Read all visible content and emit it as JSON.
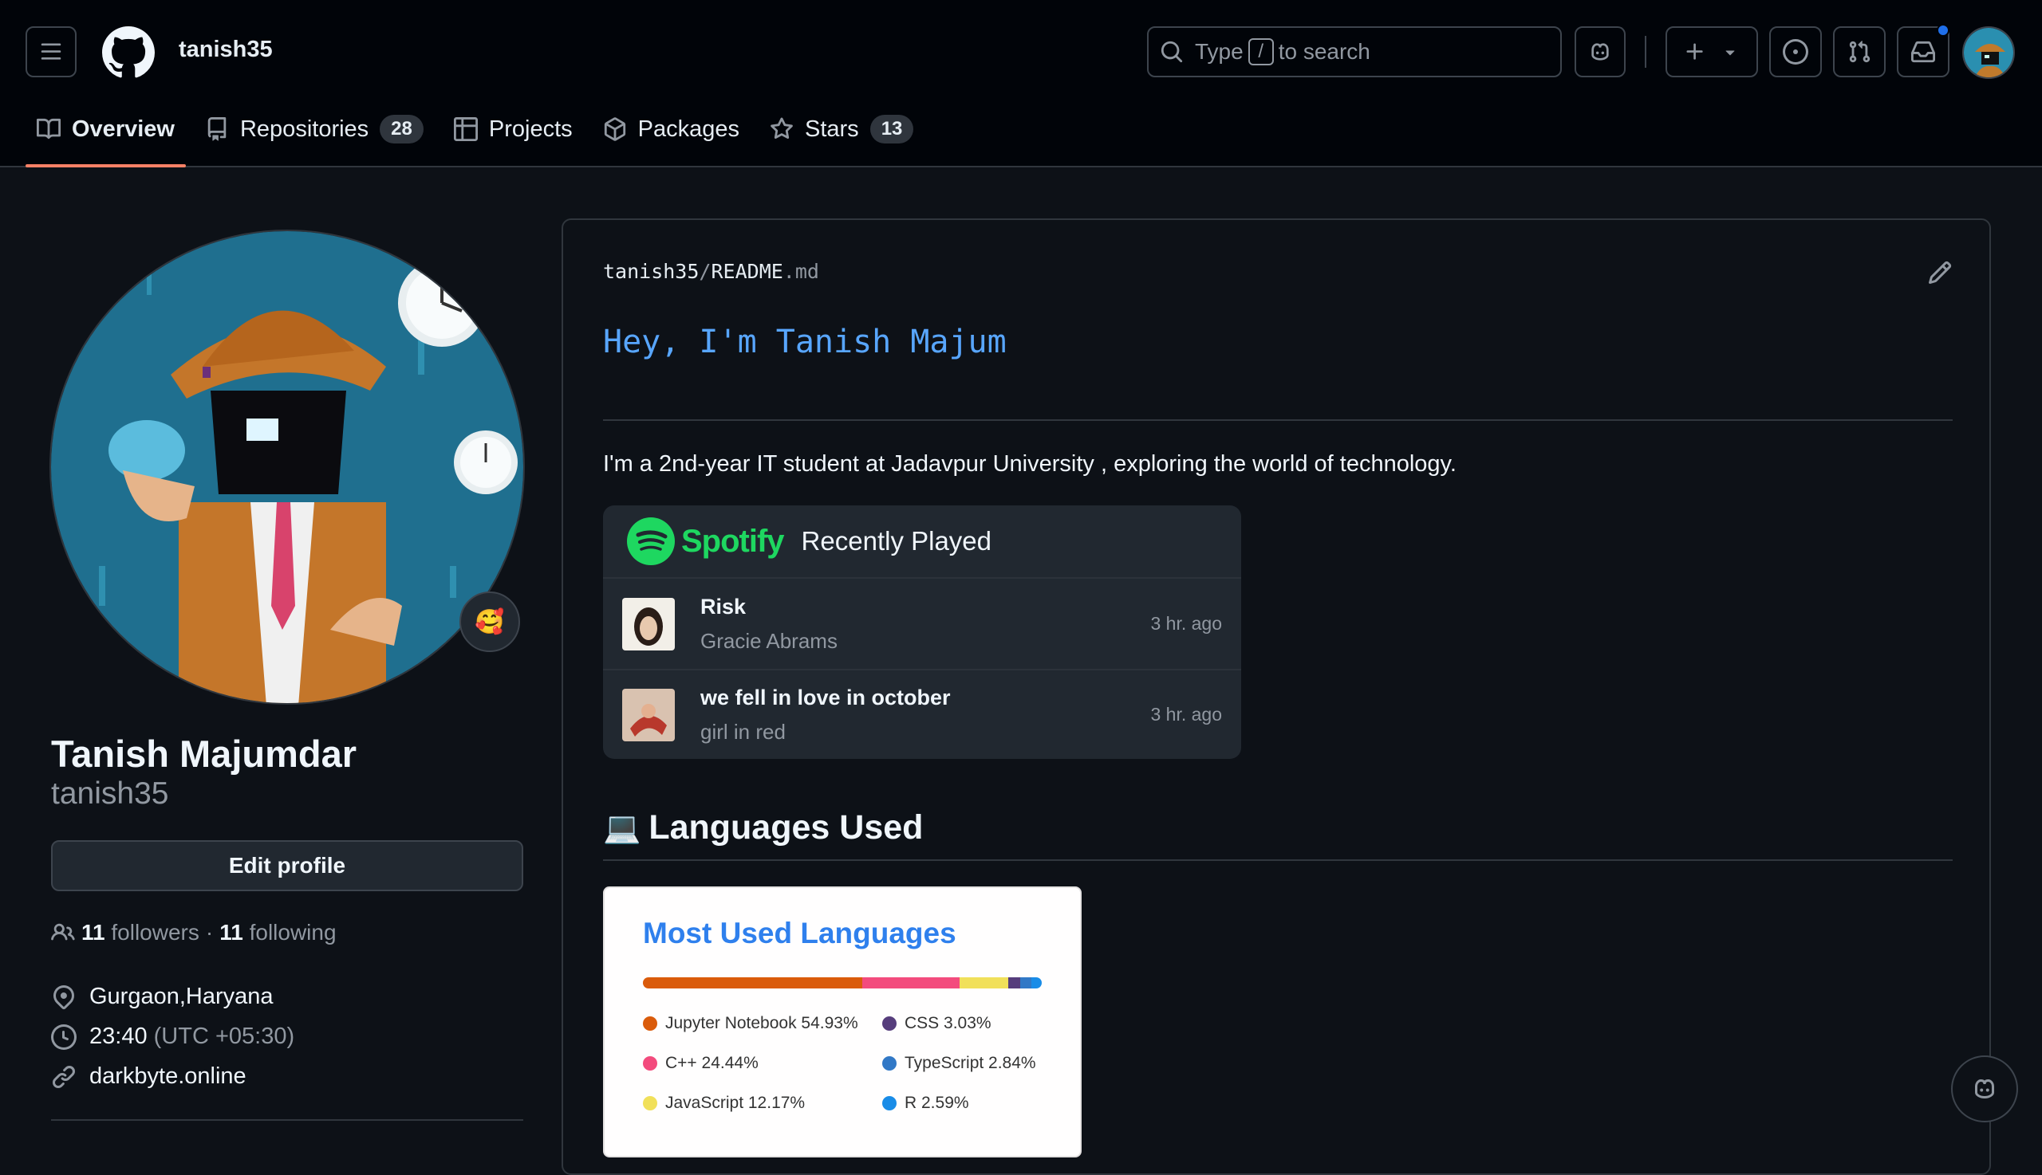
{
  "header": {
    "username": "tanish35",
    "search": {
      "prefix": "Type",
      "key": "/",
      "suffix": "to search"
    }
  },
  "tabs": [
    {
      "label": "Overview",
      "icon": "book-icon",
      "active": true
    },
    {
      "label": "Repositories",
      "icon": "repo-icon",
      "count": "28"
    },
    {
      "label": "Projects",
      "icon": "table-icon"
    },
    {
      "label": "Packages",
      "icon": "package-icon"
    },
    {
      "label": "Stars",
      "icon": "star-icon",
      "count": "13"
    }
  ],
  "profile": {
    "full_name": "Tanish Majumdar",
    "login": "tanish35",
    "status_emoji": "🥰",
    "edit_label": "Edit profile",
    "followers": "11",
    "followers_label": "followers",
    "separator": "·",
    "following": "11",
    "following_label": "following",
    "location": "Gurgaon,Haryana",
    "time": "23:40",
    "timezone": "(UTC +05:30)",
    "website": "darkbyte.online"
  },
  "readme": {
    "owner": "tanish35",
    "slash": "/",
    "file": "README",
    "ext": ".md",
    "heading": "Hey, I'm Tanish Majum",
    "intro": "I'm a 2nd-year IT student at Jadavpur University , exploring the world of technology.",
    "spotify": {
      "brand": "Spotify",
      "header": "Recently Played",
      "tracks": [
        {
          "title": "Risk",
          "artist": "Gracie Abrams",
          "time": "3 hr. ago"
        },
        {
          "title": "we fell in love in october",
          "artist": "girl in red",
          "time": "3 hr. ago"
        }
      ]
    },
    "languages_heading": "Languages Used",
    "languages_emoji": "💻",
    "card_title": "Most Used Languages",
    "languages": [
      {
        "label": "Jupyter Notebook 54.93%",
        "pct": 54.93,
        "color": "#DA5B0B"
      },
      {
        "label": "C++ 24.44%",
        "pct": 24.44,
        "color": "#F34B7D"
      },
      {
        "label": "JavaScript 12.17%",
        "pct": 12.17,
        "color": "#F1E05A"
      },
      {
        "label": "CSS 3.03%",
        "pct": 3.03,
        "color": "#563D7C"
      },
      {
        "label": "TypeScript 2.84%",
        "pct": 2.84,
        "color": "#3178C6"
      },
      {
        "label": "R 2.59%",
        "pct": 2.59,
        "color": "#198CE7"
      }
    ]
  }
}
